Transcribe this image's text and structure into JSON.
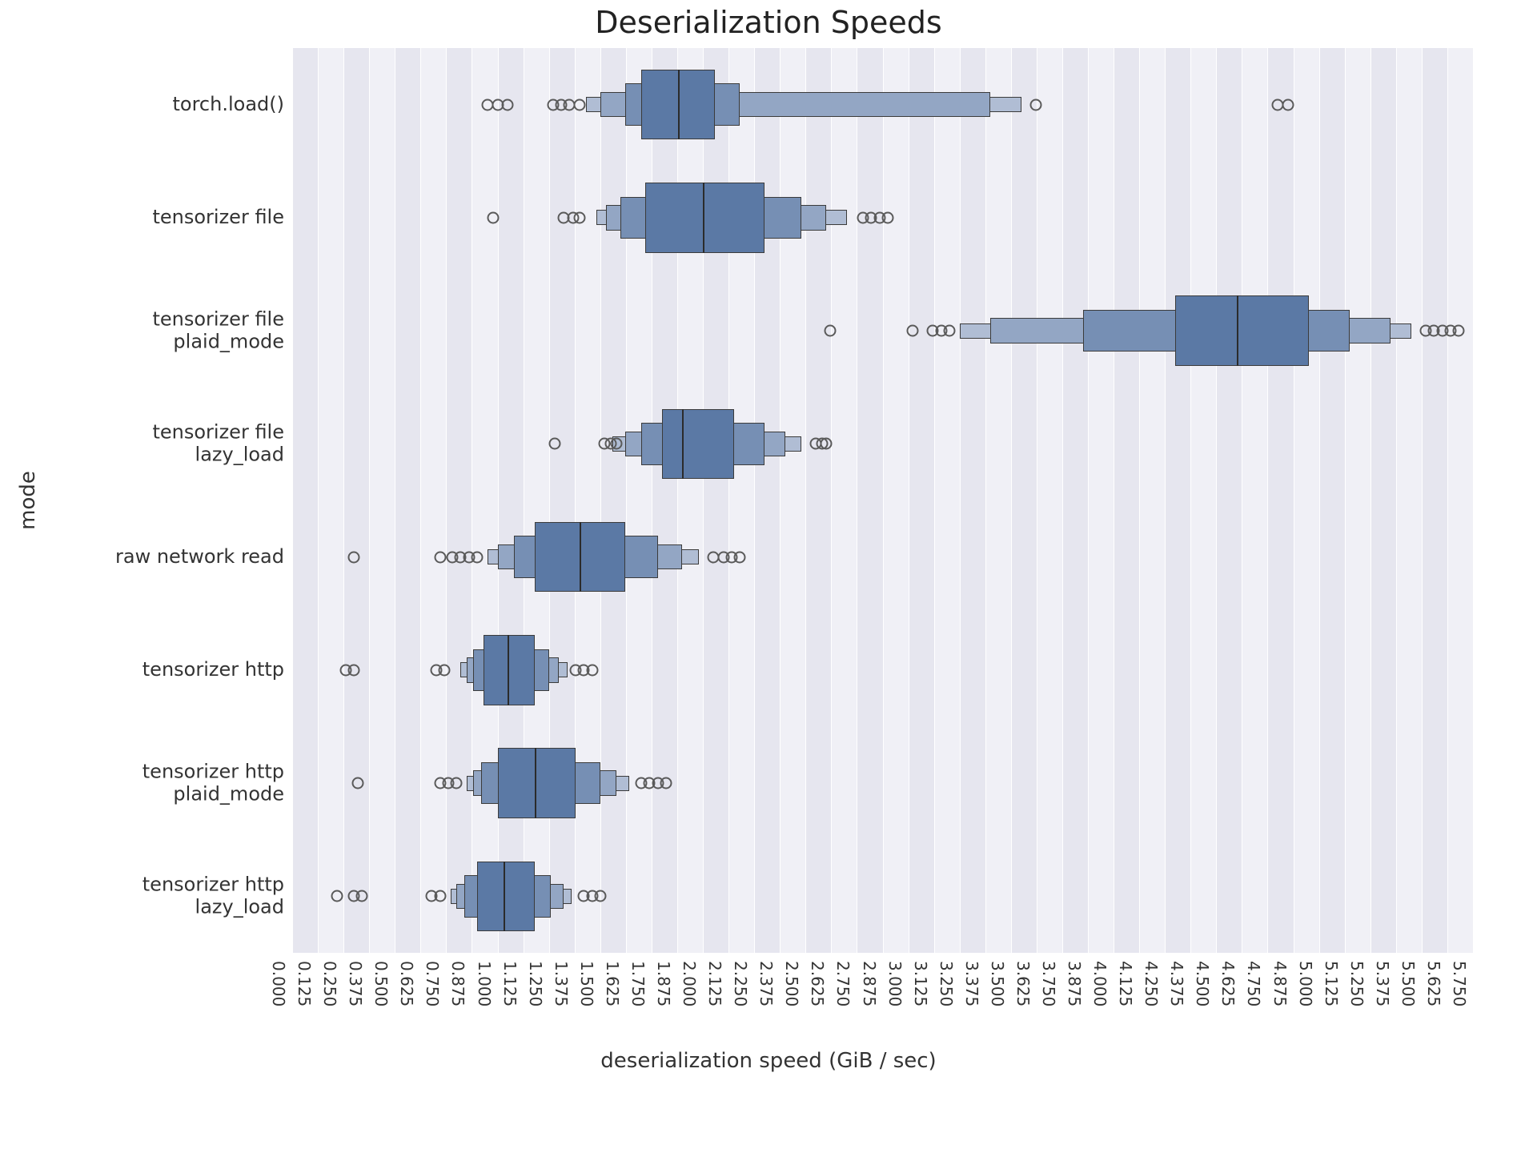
{
  "chart_data": {
    "type": "boxen",
    "title": "Deserialization Speeds",
    "xlabel": "deserialization speed (GiB / sec)",
    "ylabel": "mode",
    "xlim": [
      0.0,
      5.75
    ],
    "xticks": [
      0.0,
      0.125,
      0.25,
      0.375,
      0.5,
      0.625,
      0.75,
      0.875,
      1.0,
      1.125,
      1.25,
      1.375,
      1.5,
      1.625,
      1.75,
      1.875,
      2.0,
      2.125,
      2.25,
      2.375,
      2.5,
      2.625,
      2.75,
      2.875,
      3.0,
      3.125,
      3.25,
      3.375,
      3.5,
      3.625,
      3.75,
      3.875,
      4.0,
      4.125,
      4.25,
      4.375,
      4.5,
      4.625,
      4.75,
      4.875,
      5.0,
      5.125,
      5.25,
      5.375,
      5.5,
      5.625,
      5.75
    ],
    "categories": [
      "torch.load()",
      "tensorizer file",
      "tensorizer file\nplaid_mode",
      "tensorizer file\nlazy_load",
      "raw network read",
      "tensorizer http",
      "tensorizer http\nplaid_mode",
      "tensorizer http\nlazy_load"
    ],
    "series": [
      {
        "name": "torch.load()",
        "median": 1.88,
        "boxes": [
          {
            "low": 1.7,
            "high": 2.06
          },
          {
            "low": 1.62,
            "high": 2.18
          },
          {
            "low": 1.5,
            "high": 3.4
          },
          {
            "low": 1.43,
            "high": 3.55
          }
        ],
        "outliers": [
          0.95,
          1.0,
          1.05,
          1.27,
          1.31,
          1.35,
          1.4,
          3.62,
          4.8,
          4.85
        ]
      },
      {
        "name": "tensorizer file",
        "median": 2.0,
        "boxes": [
          {
            "low": 1.72,
            "high": 2.3
          },
          {
            "low": 1.6,
            "high": 2.48
          },
          {
            "low": 1.53,
            "high": 2.6
          },
          {
            "low": 1.48,
            "high": 2.7
          }
        ],
        "outliers": [
          0.98,
          1.32,
          1.37,
          1.4,
          2.78,
          2.82,
          2.86,
          2.9
        ]
      },
      {
        "name": "tensorizer file\nplaid_mode",
        "median": 4.6,
        "boxes": [
          {
            "low": 4.3,
            "high": 4.95
          },
          {
            "low": 3.85,
            "high": 5.15
          },
          {
            "low": 3.4,
            "high": 5.35
          },
          {
            "low": 3.25,
            "high": 5.45
          }
        ],
        "outliers": [
          2.62,
          3.02,
          3.12,
          3.16,
          3.2,
          5.52,
          5.56,
          5.6,
          5.64,
          5.68
        ]
      },
      {
        "name": "tensorizer file\nlazy_load",
        "median": 1.9,
        "boxes": [
          {
            "low": 1.8,
            "high": 2.15
          },
          {
            "low": 1.7,
            "high": 2.3
          },
          {
            "low": 1.62,
            "high": 2.4
          },
          {
            "low": 1.56,
            "high": 2.48
          }
        ],
        "outliers": [
          1.28,
          1.52,
          1.55,
          1.58,
          2.55,
          2.58,
          2.6
        ]
      },
      {
        "name": "raw network read",
        "median": 1.4,
        "boxes": [
          {
            "low": 1.18,
            "high": 1.62
          },
          {
            "low": 1.08,
            "high": 1.78
          },
          {
            "low": 1.0,
            "high": 1.9
          },
          {
            "low": 0.95,
            "high": 1.98
          }
        ],
        "outliers": [
          0.3,
          0.72,
          0.78,
          0.82,
          0.86,
          0.9,
          2.05,
          2.1,
          2.14,
          2.18
        ]
      },
      {
        "name": "tensorizer http",
        "median": 1.05,
        "boxes": [
          {
            "low": 0.93,
            "high": 1.18
          },
          {
            "low": 0.88,
            "high": 1.25
          },
          {
            "low": 0.85,
            "high": 1.3
          },
          {
            "low": 0.82,
            "high": 1.34
          }
        ],
        "outliers": [
          0.26,
          0.3,
          0.7,
          0.74,
          1.38,
          1.42,
          1.46
        ]
      },
      {
        "name": "tensorizer http\nplaid_mode",
        "median": 1.18,
        "boxes": [
          {
            "low": 1.0,
            "high": 1.38
          },
          {
            "low": 0.92,
            "high": 1.5
          },
          {
            "low": 0.88,
            "high": 1.58
          },
          {
            "low": 0.85,
            "high": 1.64
          }
        ],
        "outliers": [
          0.32,
          0.72,
          0.76,
          0.8,
          1.7,
          1.74,
          1.78,
          1.82
        ]
      },
      {
        "name": "tensorizer http\nlazy_load",
        "median": 1.03,
        "boxes": [
          {
            "low": 0.9,
            "high": 1.18
          },
          {
            "low": 0.84,
            "high": 1.26
          },
          {
            "low": 0.8,
            "high": 1.32
          },
          {
            "low": 0.77,
            "high": 1.36
          }
        ],
        "outliers": [
          0.22,
          0.3,
          0.34,
          0.68,
          0.72,
          1.42,
          1.46,
          1.5
        ]
      }
    ]
  }
}
